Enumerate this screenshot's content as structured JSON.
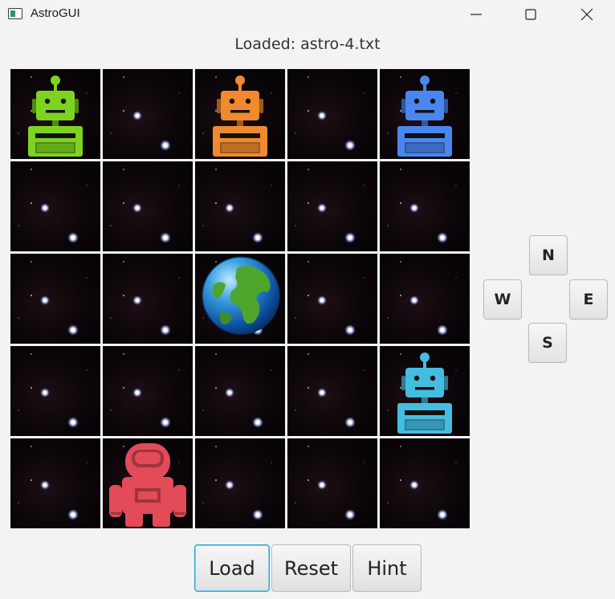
{
  "window": {
    "title": "AstroGUI"
  },
  "status": "Loaded: astro-4.txt",
  "board": {
    "rows": 5,
    "cols": 5,
    "cells": [
      [
        "robot-green",
        "space",
        "robot-orange",
        "space",
        "robot-blue"
      ],
      [
        "space",
        "space",
        "space",
        "space",
        "space"
      ],
      [
        "space",
        "space",
        "earth",
        "space",
        "space"
      ],
      [
        "space",
        "space",
        "space",
        "space",
        "robot-cyan"
      ],
      [
        "space",
        "astronaut-red",
        "space",
        "space",
        "space"
      ]
    ]
  },
  "colors": {
    "robot-green": "#7ed321",
    "robot-orange": "#f08a2e",
    "robot-blue": "#4a86f0",
    "robot-cyan": "#45bde0",
    "astronaut-red": "#e24b57"
  },
  "directions": {
    "north": "N",
    "west": "W",
    "east": "E",
    "south": "S"
  },
  "buttons": {
    "load": "Load",
    "reset": "Reset",
    "hint": "Hint"
  }
}
